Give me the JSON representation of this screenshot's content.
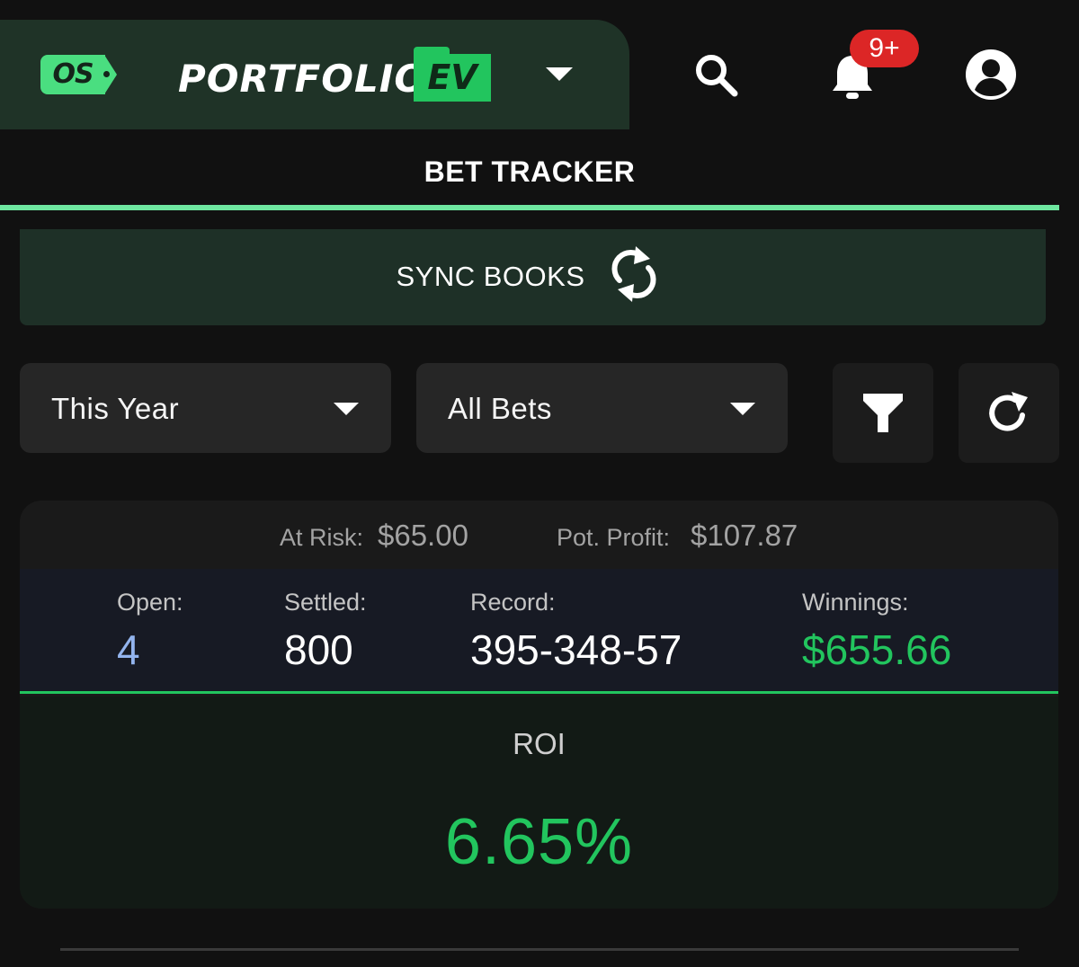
{
  "header": {
    "logo_os": "OS",
    "brand_name": "PORTFOLIO",
    "brand_badge": "EV",
    "notification_badge": "9+",
    "icons": [
      "chevron-down-icon",
      "search-icon",
      "bell-icon",
      "account-circle-icon"
    ]
  },
  "tabs": [
    {
      "label": "BET TRACKER",
      "active": true
    }
  ],
  "sync": {
    "label": "SYNC BOOKS",
    "icon": "sync-icon"
  },
  "filters": {
    "time_range": "This Year",
    "bet_type": "All Bets",
    "icons": [
      "filter-icon",
      "refresh-icon"
    ]
  },
  "summary": {
    "at_risk_label": "At Risk:",
    "at_risk_value": "$65.00",
    "pot_profit_label": "Pot. Profit:",
    "pot_profit_value": "$107.87",
    "open_label": "Open:",
    "open_value": "4",
    "settled_label": "Settled:",
    "settled_value": "800",
    "record_label": "Record:",
    "record_value": "395-348-57",
    "winnings_label": "Winnings:",
    "winnings_value": "$655.66",
    "roi_label": "ROI",
    "roi_value": "6.65%"
  },
  "colors": {
    "accent_green": "#22c55e",
    "tab_underline": "#6ee7a0",
    "brand_panel": "#1f3327",
    "badge_red": "#dc2626",
    "open_blue": "#93b4ee"
  }
}
